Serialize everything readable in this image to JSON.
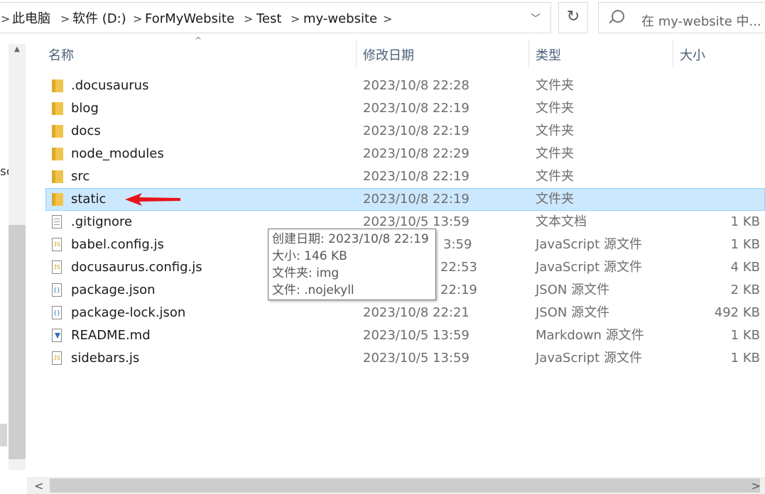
{
  "address_bar": {
    "crumbs": [
      "此电脑",
      "软件 (D:)",
      "ForMyWebsite",
      "Test",
      "my-website"
    ],
    "separator": ">",
    "refresh_glyph": "↻",
    "dropdown_glyph": "﹀"
  },
  "search": {
    "placeholder": "在 my-website 中..."
  },
  "left_pane": {
    "partial_text": "sc"
  },
  "columns": {
    "name": "名称",
    "date": "修改日期",
    "type": "类型",
    "size": "大小",
    "sort_glyph": "^"
  },
  "files": [
    {
      "name": ".docusaurus",
      "date": "2023/10/8 22:28",
      "type": "文件夹",
      "size": "",
      "icon": "folder-icon"
    },
    {
      "name": "blog",
      "date": "2023/10/8 22:19",
      "type": "文件夹",
      "size": "",
      "icon": "folder-icon"
    },
    {
      "name": "docs",
      "date": "2023/10/8 22:19",
      "type": "文件夹",
      "size": "",
      "icon": "folder-icon"
    },
    {
      "name": "node_modules",
      "date": "2023/10/8 22:29",
      "type": "文件夹",
      "size": "",
      "icon": "folder-icon"
    },
    {
      "name": "src",
      "date": "2023/10/8 22:19",
      "type": "文件夹",
      "size": "",
      "icon": "folder-icon"
    },
    {
      "name": "static",
      "date": "2023/10/8 22:19",
      "type": "文件夹",
      "size": "",
      "icon": "folder-icon"
    },
    {
      "name": ".gitignore",
      "date": "2023/10/5 13:59",
      "type": "文本文档",
      "size": "1 KB",
      "icon": "text-file-icon"
    },
    {
      "name": "babel.config.js",
      "date": "3:59",
      "type": "JavaScript 源文件",
      "size": "1 KB",
      "icon": "js-file-icon"
    },
    {
      "name": "docusaurus.config.js",
      "date": "22:53",
      "type": "JavaScript 源文件",
      "size": "4 KB",
      "icon": "js-file-icon"
    },
    {
      "name": "package.json",
      "date": "22:19",
      "type": "JSON 源文件",
      "size": "2 KB",
      "icon": "json-file-icon"
    },
    {
      "name": "package-lock.json",
      "date": "2023/10/8 22:21",
      "type": "JSON 源文件",
      "size": "492 KB",
      "icon": "json-file-icon"
    },
    {
      "name": "README.md",
      "date": "2023/10/5 13:59",
      "type": "Markdown 源文件",
      "size": "1 KB",
      "icon": "markdown-file-icon"
    },
    {
      "name": "sidebars.js",
      "date": "2023/10/5 13:59",
      "type": "JavaScript 源文件",
      "size": "1 KB",
      "icon": "js-file-icon"
    }
  ],
  "selected_file": "static",
  "tooltip": {
    "created": "创建日期: 2023/10/8 22:19",
    "size": "大小: 146 KB",
    "folders": "文件夹: img",
    "files": "文件: .nojekyll"
  },
  "colors": {
    "selection": "#cce8ff",
    "selection_border": "#99d1ff",
    "annotation_arrow": "#e8141a",
    "folder": "#f0c44c"
  }
}
